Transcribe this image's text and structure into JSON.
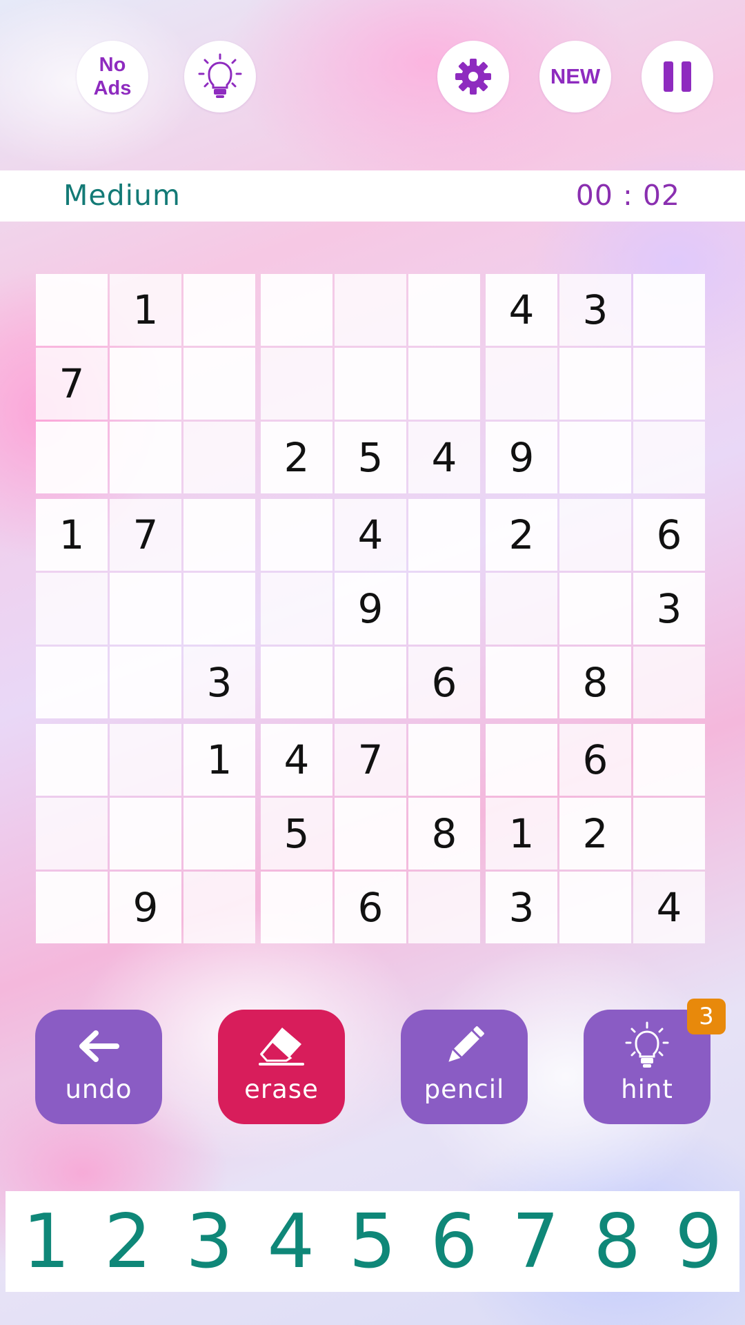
{
  "header": {
    "no_ads_line1": "No",
    "no_ads_line2": "Ads",
    "new_label": "NEW",
    "icons": [
      "lightbulb-icon",
      "gear-icon",
      "pause-icon"
    ]
  },
  "status": {
    "difficulty": "Medium",
    "timer": "00 : 02"
  },
  "board": {
    "rows": [
      [
        "",
        "1",
        "",
        "",
        "",
        "",
        "4",
        "3",
        ""
      ],
      [
        "7",
        "",
        "",
        "",
        "",
        "",
        "",
        "",
        ""
      ],
      [
        "",
        "",
        "",
        "2",
        "5",
        "4",
        "9",
        "",
        ""
      ],
      [
        "1",
        "7",
        "",
        "",
        "4",
        "",
        "2",
        "",
        "6"
      ],
      [
        "",
        "",
        "",
        "",
        "9",
        "",
        "",
        "",
        "3"
      ],
      [
        "",
        "",
        "3",
        "",
        "",
        "6",
        "",
        "8",
        ""
      ],
      [
        "",
        "",
        "1",
        "4",
        "7",
        "",
        "",
        "6",
        ""
      ],
      [
        "",
        "",
        "",
        "5",
        "",
        "8",
        "1",
        "2",
        ""
      ],
      [
        "",
        "9",
        "",
        "",
        "6",
        "",
        "3",
        "",
        "4"
      ]
    ]
  },
  "actions": {
    "undo": "undo",
    "erase": "erase",
    "pencil": "pencil",
    "hint": "hint",
    "hint_count": "3"
  },
  "numpad": [
    "1",
    "2",
    "3",
    "4",
    "5",
    "6",
    "7",
    "8",
    "9"
  ],
  "colors": {
    "accent_purple": "#8a5cc4",
    "erase_red": "#d81d5b",
    "badge_orange": "#e8890b",
    "numpad_teal": "#0f8778",
    "difficulty_teal": "#137a76",
    "timer_purple": "#8a2fb0"
  }
}
